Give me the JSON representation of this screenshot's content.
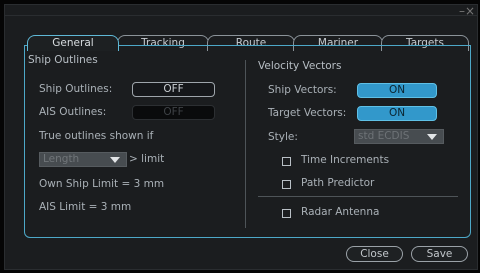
{
  "window": {
    "close_glyph": "–×"
  },
  "tabs": [
    {
      "label": "General",
      "active": true
    },
    {
      "label": "Tracking",
      "active": false
    },
    {
      "label": "Route",
      "active": false
    },
    {
      "label": "Mariner",
      "active": false
    },
    {
      "label": "Targets",
      "active": false
    }
  ],
  "ship_outlines": {
    "title": "Ship Outlines",
    "ship_outlines_label": "Ship Outlines:",
    "ship_outlines_value": "OFF",
    "ais_outlines_label": "AIS Outlines:",
    "ais_outlines_value": "OFF",
    "true_outlines_label": "True outlines shown if",
    "length_select_value": "Length",
    "limit_label": "> limit",
    "own_ship_limit": "Own Ship Limit = 3 mm",
    "ais_limit": "AIS Limit = 3 mm"
  },
  "velocity_vectors": {
    "title": "Velocity Vectors",
    "ship_vectors_label": "Ship Vectors:",
    "ship_vectors_value": "ON",
    "target_vectors_label": "Target Vectors:",
    "target_vectors_value": "ON",
    "style_label": "Style:",
    "style_value": "std ECDIS",
    "time_increments_label": "Time Increments",
    "path_predictor_label": "Path Predictor",
    "radar_antenna_label": "Radar Antenna"
  },
  "footer": {
    "close_label": "Close",
    "save_label": "Save"
  },
  "colors": {
    "accent": "#3298cb",
    "panel_border": "#4da8c8",
    "background": "#1b1d1f"
  }
}
